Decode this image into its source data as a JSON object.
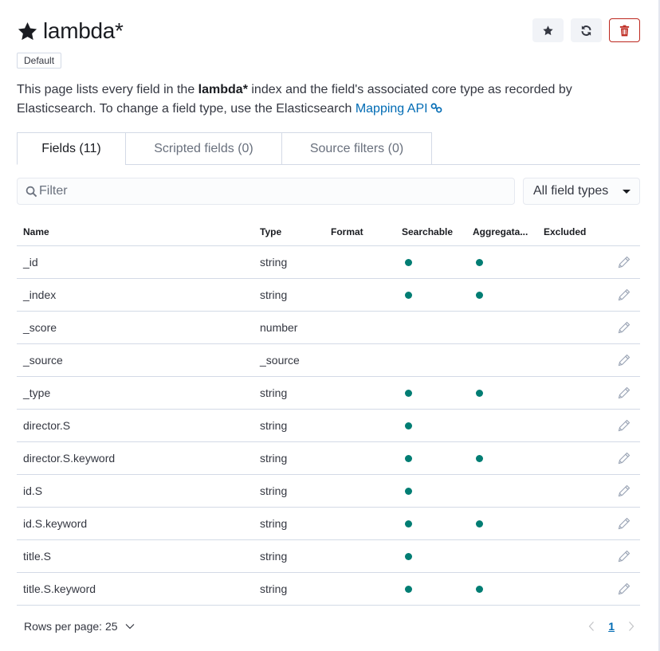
{
  "header": {
    "title": "lambda*",
    "star_icon": "star-filled-icon",
    "actions": [
      {
        "name": "set-default-button",
        "icon": "star-icon"
      },
      {
        "name": "refresh-fields-button",
        "icon": "refresh-icon"
      },
      {
        "name": "delete-index-pattern-button",
        "icon": "trash-icon",
        "color": "#bd271e"
      }
    ]
  },
  "badge": "Default",
  "description": {
    "prefix": "This page lists every field in the ",
    "index_name": "lambda*",
    "middle": " index and the field's associated core type as recorded by Elasticsearch. To change a field type, use the Elasticsearch ",
    "link_text": "Mapping API",
    "link_icon": "link-icon"
  },
  "tabs": [
    {
      "label": "Fields (11)",
      "active": true
    },
    {
      "label": "Scripted fields (0)",
      "active": false
    },
    {
      "label": "Source filters (0)",
      "active": false
    }
  ],
  "filter": {
    "placeholder": "Filter",
    "value": "",
    "icon": "search-icon"
  },
  "type_select": {
    "selected": "All field types"
  },
  "table": {
    "columns": [
      "Name",
      "Type",
      "Format",
      "Searchable",
      "Aggregata...",
      "Excluded"
    ],
    "rows": [
      {
        "name": "_id",
        "type": "string",
        "format": "",
        "searchable": true,
        "aggregatable": true,
        "excluded": false
      },
      {
        "name": "_index",
        "type": "string",
        "format": "",
        "searchable": true,
        "aggregatable": true,
        "excluded": false
      },
      {
        "name": "_score",
        "type": "number",
        "format": "",
        "searchable": false,
        "aggregatable": false,
        "excluded": false
      },
      {
        "name": "_source",
        "type": "_source",
        "format": "",
        "searchable": false,
        "aggregatable": false,
        "excluded": false
      },
      {
        "name": "_type",
        "type": "string",
        "format": "",
        "searchable": true,
        "aggregatable": true,
        "excluded": false
      },
      {
        "name": "director.S",
        "type": "string",
        "format": "",
        "searchable": true,
        "aggregatable": false,
        "excluded": false
      },
      {
        "name": "director.S.keyword",
        "type": "string",
        "format": "",
        "searchable": true,
        "aggregatable": true,
        "excluded": false
      },
      {
        "name": "id.S",
        "type": "string",
        "format": "",
        "searchable": true,
        "aggregatable": false,
        "excluded": false
      },
      {
        "name": "id.S.keyword",
        "type": "string",
        "format": "",
        "searchable": true,
        "aggregatable": true,
        "excluded": false
      },
      {
        "name": "title.S",
        "type": "string",
        "format": "",
        "searchable": true,
        "aggregatable": false,
        "excluded": false
      },
      {
        "name": "title.S.keyword",
        "type": "string",
        "format": "",
        "searchable": true,
        "aggregatable": true,
        "excluded": false
      }
    ],
    "indicator_color": "#017d73"
  },
  "pagination": {
    "rows_per_page_label": "Rows per page: 25",
    "current_page": "1"
  },
  "colors": {
    "link": "#006bb4",
    "danger": "#bd271e",
    "border": "#d3dae6"
  }
}
